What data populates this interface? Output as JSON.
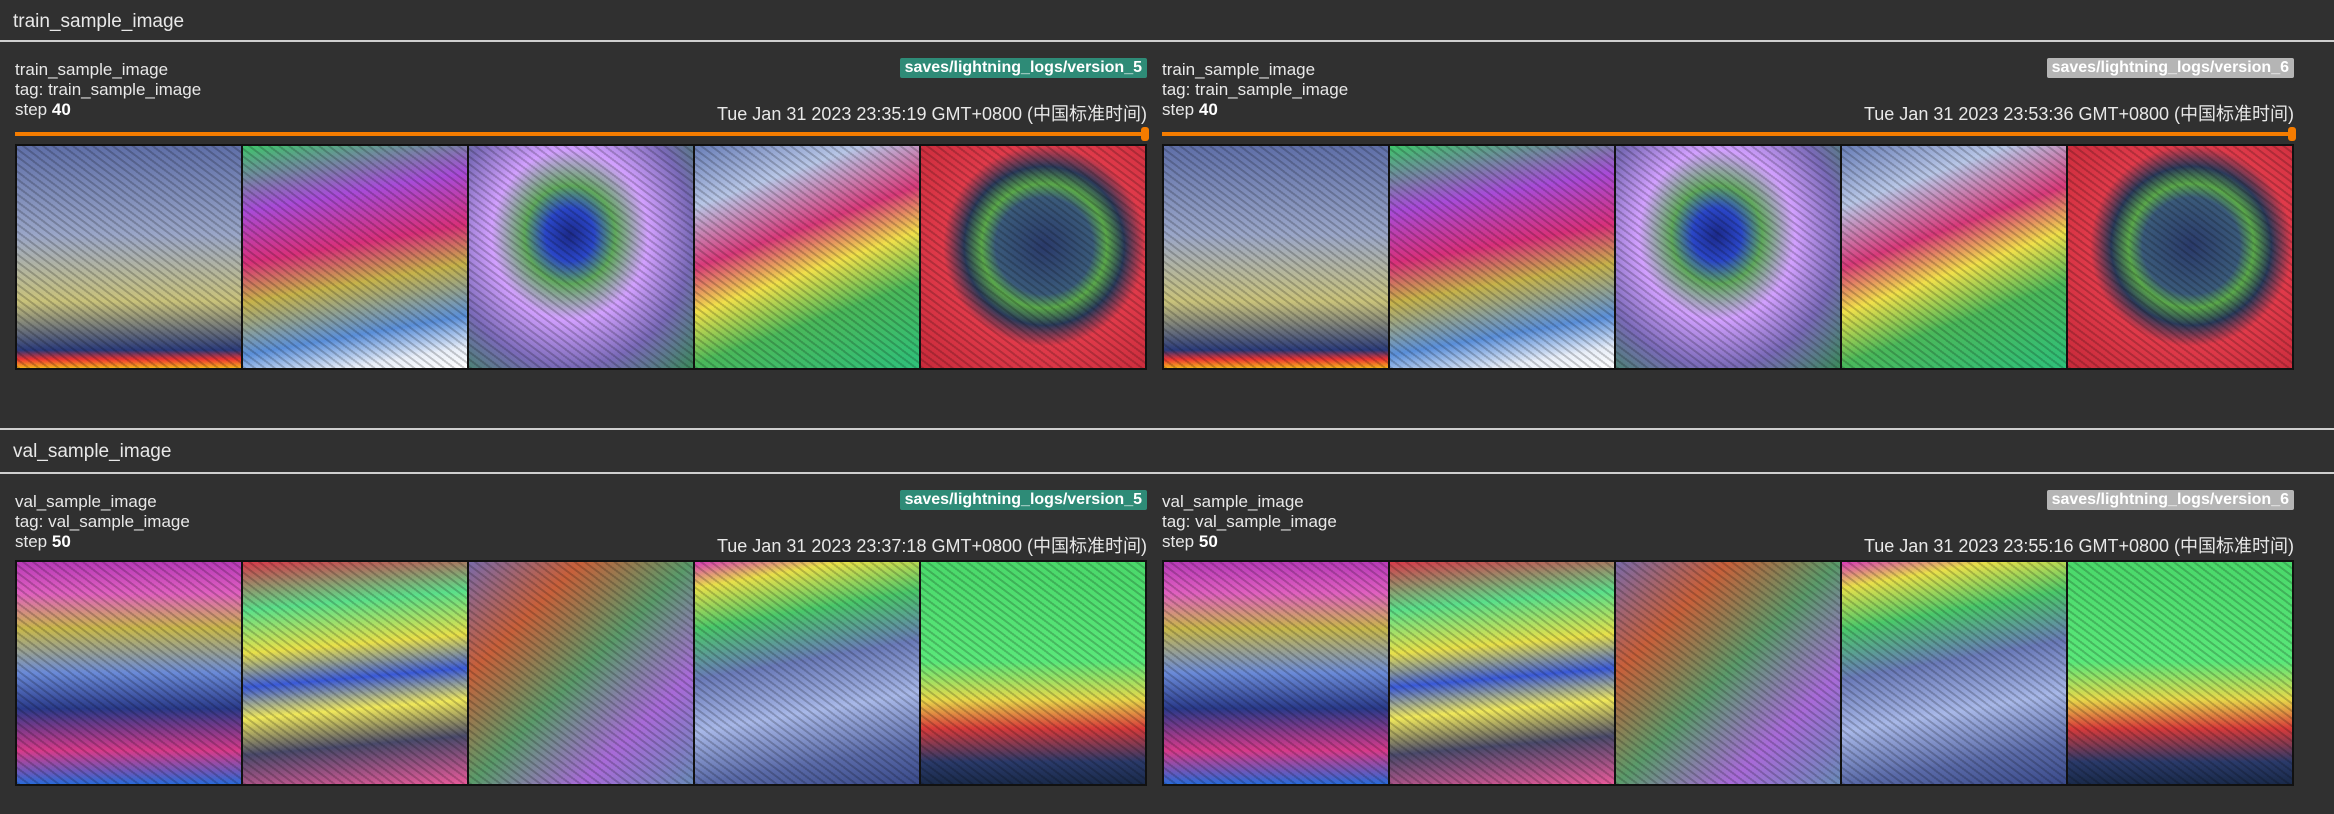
{
  "groups": [
    {
      "header": "train_sample_image",
      "cards": [
        {
          "title": "train_sample_image",
          "tag": "tag: train_sample_image",
          "step_prefix": "step",
          "step": "40",
          "run": "saves/lightning_logs/version_5",
          "run_color": "#2e8b77",
          "timestamp": "Tue Jan 31 2023 23:35:19 GMT+0800 (中国标准时间)",
          "show_slider": true
        },
        {
          "title": "train_sample_image",
          "tag": "tag: train_sample_image",
          "step_prefix": "step",
          "step": "40",
          "run": "saves/lightning_logs/version_6",
          "run_color": "#b5b5b5",
          "timestamp": "Tue Jan 31 2023 23:53:36 GMT+0800 (中国标准时间)",
          "show_slider": true
        }
      ]
    },
    {
      "header": "val_sample_image",
      "cards": [
        {
          "title": "val_sample_image",
          "tag": "tag: val_sample_image",
          "step_prefix": "step",
          "step": "50",
          "run": "saves/lightning_logs/version_5",
          "run_color": "#2e8b77",
          "timestamp": "Tue Jan 31 2023 23:37:18 GMT+0800 (中国标准时间)",
          "show_slider": false
        },
        {
          "title": "val_sample_image",
          "tag": "tag: val_sample_image",
          "step_prefix": "step",
          "step": "50",
          "run": "saves/lightning_logs/version_6",
          "run_color": "#b5b5b5",
          "timestamp": "Tue Jan 31 2023 23:55:16 GMT+0800 (中国标准时间)",
          "show_slider": false
        }
      ]
    }
  ],
  "colors": {
    "slider": "#f57c00",
    "background": "#303030"
  }
}
